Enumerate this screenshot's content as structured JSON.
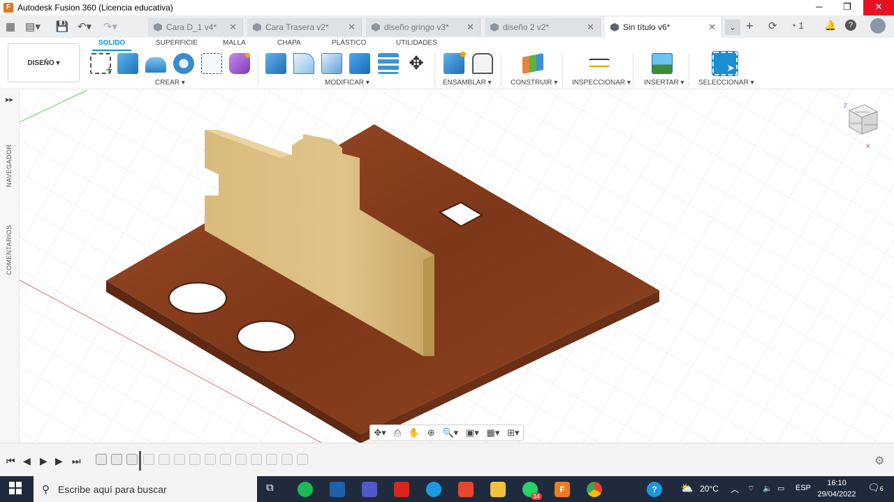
{
  "window": {
    "title": "Autodesk Fusion 360 (Licencia educativa)",
    "app_icon": "F"
  },
  "tabs": [
    {
      "label": "Cara D_1 v4*"
    },
    {
      "label": "Cara Trasera v2*"
    },
    {
      "label": "diseño gringo v3*"
    },
    {
      "label": "diseño 2 v2*"
    },
    {
      "label": "Sin título v6*"
    }
  ],
  "toolbar": {
    "job_count": "1"
  },
  "workspace": {
    "label": "DISEÑO ▾"
  },
  "ribbon_tabs": [
    "SOLIDO",
    "SUPERFICIE",
    "MALLA",
    "CHAPA",
    "PLÁSTICO",
    "UTILIDADES"
  ],
  "groups": {
    "crear": "CREAR ▾",
    "modificar": "MODIFICAR ▾",
    "ensamblar": "ENSAMBLAR ▾",
    "construir": "CONSTRUIR ▾",
    "inspeccionar": "INSPECCIONAR ▾",
    "insertar": "INSERTAR ▾",
    "seleccionar": "SELECCIONAR ▾"
  },
  "side": {
    "navegador": "NAVEGADOR",
    "comentarios": "COMENTARIOS"
  },
  "viewcube": {
    "top": "SUPERIOR",
    "front": "FRONTAL",
    "right": "DERECHA",
    "z": "Z",
    "x": "X"
  },
  "taskbar": {
    "search_placeholder": "Escribe aquí para buscar",
    "whatsapp_badge": "34",
    "temperature": "20°C",
    "language": "ESP",
    "time": "16:10",
    "date": "29/04/2022",
    "notifications": "6"
  },
  "colors": {
    "accent": "#0696d7",
    "board": "#8a3f1f",
    "panel": "#d9b574",
    "taskbar": "#1f2b3d"
  }
}
